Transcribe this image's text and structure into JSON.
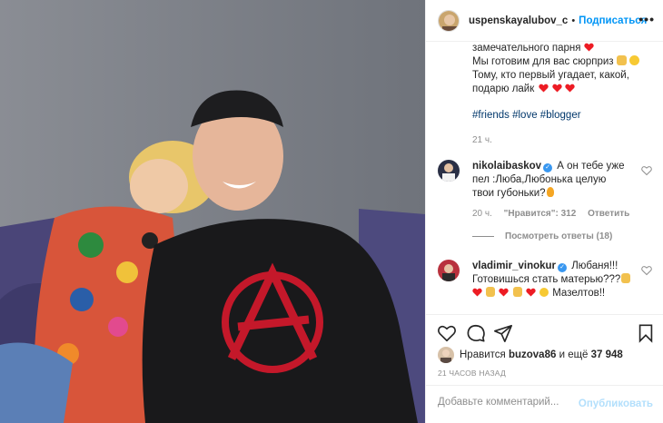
{
  "header": {
    "username": "uspenskayalubov_c",
    "separator": "•",
    "follow_label": "Подписаться",
    "more_icon": "ellipsis-icon"
  },
  "caption": {
    "line1": "замечательного парня",
    "line2": "Мы готовим для вас сюрприз",
    "line3": "Тому, кто первый угадает, какой,",
    "line4": "подарю лайк",
    "hashtags": "#friends #love #blogger",
    "time": "21 ч."
  },
  "comments": [
    {
      "username": "nikolaibaskov",
      "text_line1": "А он тебе уже",
      "text_line2": "пел :Люба,Любонька целую",
      "text_line3": "твои губоньки?",
      "time": "20 ч.",
      "likes": "\"Нравится\": 312",
      "reply": "Ответить",
      "view_replies": "Посмотреть ответы (18)"
    },
    {
      "username": "vladimir_vinokur",
      "text_line1": "Любаня!!!",
      "text_line2": "Готовишься стать матерью???",
      "text_line3": "Мазелтов!!"
    }
  ],
  "likes": {
    "prefix": "Нравится",
    "user": "buzova86",
    "middle": "и ещё",
    "count": "37 948"
  },
  "posted": "21 ЧАСОВ НАЗАД",
  "add_comment": {
    "placeholder": "Добавьте комментарий...",
    "post_label": "Опубликовать"
  },
  "colors": {
    "link_blue": "#0095f6",
    "hashtag": "#00376b",
    "heart_red": "#ed1c24",
    "muted": "#8e8e8e"
  }
}
